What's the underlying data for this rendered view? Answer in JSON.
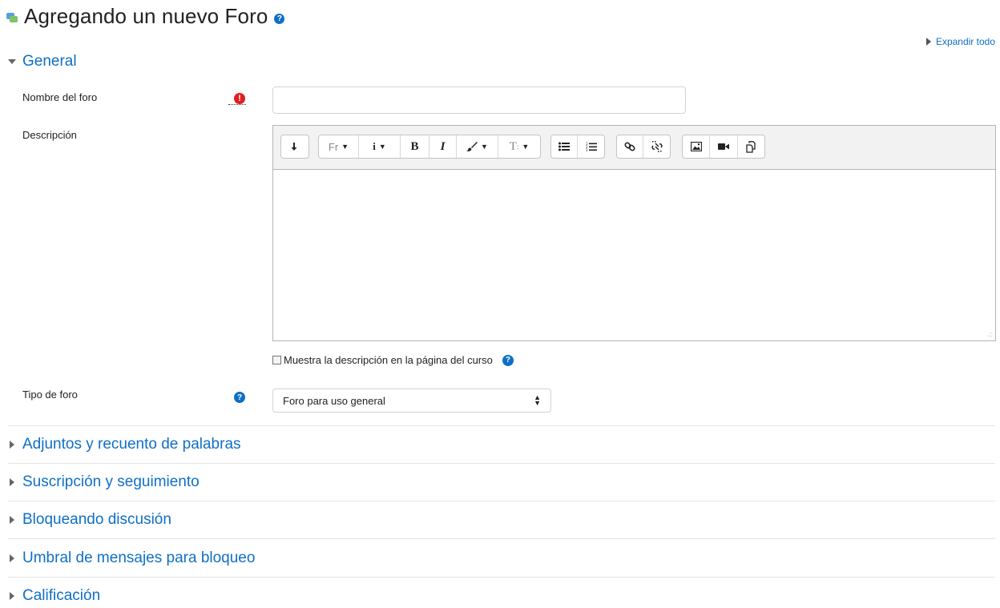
{
  "header": {
    "title": "Agregando un nuevo Foro",
    "help": "?"
  },
  "expand_all": "Expandir todo",
  "general": {
    "title": "General",
    "forum_name": {
      "label": "Nombre del foro",
      "value": "",
      "required_icon": "exclamation-icon"
    },
    "description": {
      "label": "Descripción",
      "toolbar": {
        "paragraph_label": "Fr",
        "info_label": "i",
        "bold_label": "B",
        "italic_label": "I",
        "text_style_label": "T"
      }
    },
    "show_description": {
      "label": "Muestra la descripción en la página del curso",
      "checked": false
    },
    "forum_type": {
      "label": "Tipo de foro",
      "selected": "Foro para uso general"
    }
  },
  "collapsed_sections": [
    "Adjuntos y recuento de palabras",
    "Suscripción y seguimiento",
    "Bloqueando discusión",
    "Umbral de mensajes para bloqueo",
    "Calificación"
  ],
  "colors": {
    "link": "#0f6fc5",
    "required": "#e21d1d"
  }
}
